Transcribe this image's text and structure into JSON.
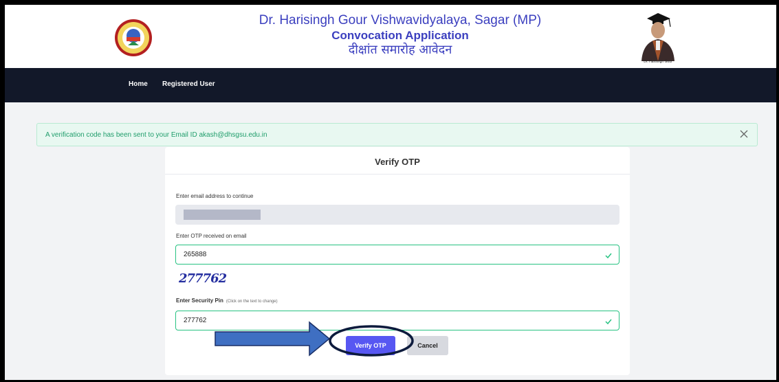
{
  "header": {
    "title_en": "Dr. Harisingh Gour Vishwavidyalaya, Sagar (MP)",
    "subtitle_en": "Convocation Application",
    "subtitle_hi": "दीक्षांत समारोह आवेदन",
    "portrait_caption": "Dr. Harisingh Gour"
  },
  "nav": {
    "home": "Home",
    "registered_user": "Registered User"
  },
  "alert": {
    "message": "A verification code has been sent to your Email ID akash@dhsgsu.edu.in"
  },
  "form": {
    "title": "Verify OTP",
    "email_label": "Enter email address to continue",
    "email_value": "",
    "otp_label": "Enter OTP received on email",
    "otp_value": "265888",
    "captcha_text": "277762",
    "pin_label": "Enter Security Pin",
    "pin_hint": "(Click on the text to change)",
    "pin_value": "277762",
    "verify_label": "Verify OTP",
    "cancel_label": "Cancel"
  },
  "colors": {
    "accent": "#5757f2",
    "success": "#26c281",
    "navbar": "#121829",
    "title": "#3b3fbf",
    "annotation_arrow": "#3f6fc2",
    "annotation_ellipse": "#0d1b3d"
  }
}
